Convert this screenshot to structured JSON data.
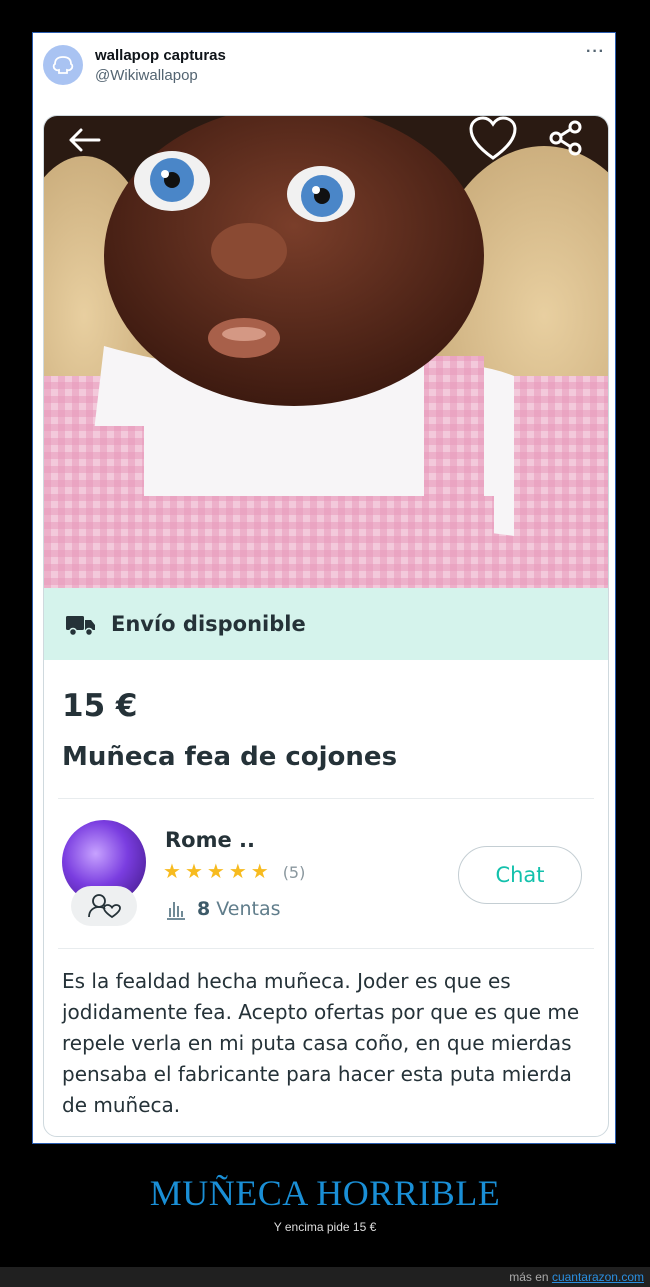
{
  "tweet": {
    "author_name": "wallapop capturas",
    "author_handle": "@Wikiwallapop",
    "more_label": "···"
  },
  "listing": {
    "shipping_label": "Envío disponible",
    "price": "15 €",
    "title": "Muñeca fea de cojones",
    "seller": {
      "name": "Rome ..",
      "rating_stars": 5,
      "rating_count": "(5)",
      "sales_count": "8",
      "sales_label": "Ventas"
    },
    "chat_label": "Chat",
    "description": "Es la fealdad hecha muñeca. Joder es que es jodidamente fea. Acepto ofertas por que es que me repele verla en mi puta casa coño, en que mierdas pensaba el fabricante para hacer esta puta mierda de muñeca."
  },
  "caption": {
    "title": "MUÑECA HORRIBLE",
    "subtitle": "Y encima pide 15 €"
  },
  "footer": {
    "prefix": "más en",
    "link": "cuantarazon.com"
  },
  "colors": {
    "accent": "#13c1ac",
    "shipping_bg": "#d5f3ec",
    "star": "#f7bb1f",
    "caption": "#1a8fd6"
  },
  "icons": [
    "back-arrow-icon",
    "heart-icon",
    "share-icon",
    "truck-icon",
    "star-icon",
    "bar-chart-icon",
    "user-heart-icon",
    "logo-icon"
  ]
}
